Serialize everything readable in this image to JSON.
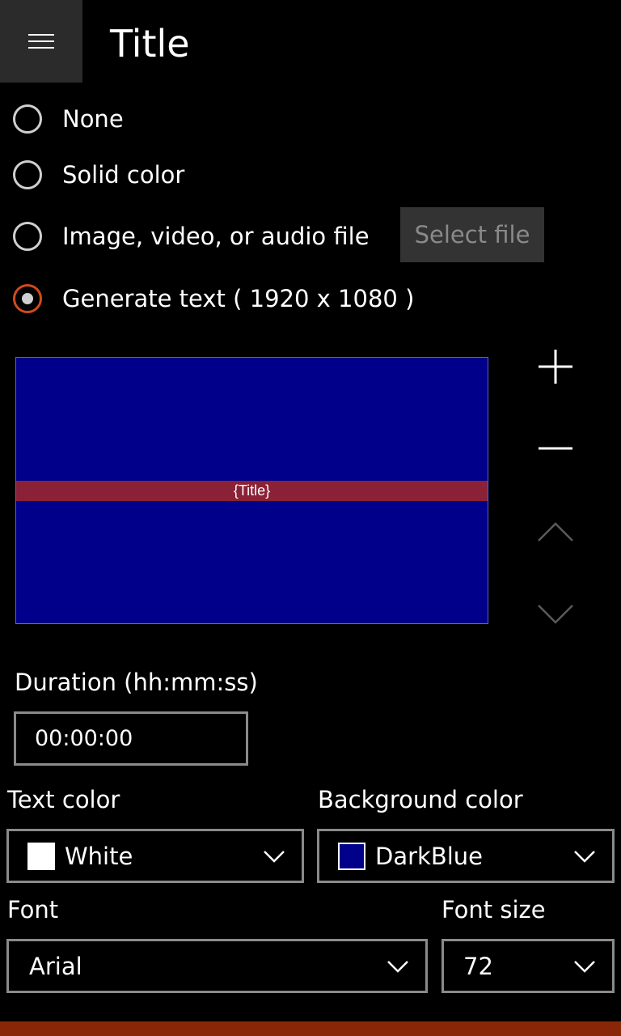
{
  "header": {
    "title": "Title",
    "menu_icon": "hamburger-icon"
  },
  "source_options": [
    {
      "label": "None",
      "checked": false
    },
    {
      "label": "Solid color",
      "checked": false
    },
    {
      "label": "Image, video, or audio file",
      "checked": false
    },
    {
      "label": "Generate text ( 1920 x 1080 )",
      "checked": true
    }
  ],
  "select_file_label": "Select file",
  "preview": {
    "title_text": "{Title}",
    "background": "#00008b",
    "band_color": "#8b2136"
  },
  "side_controls": [
    "plus-icon",
    "minus-icon",
    "chevron-up-icon",
    "chevron-down-icon"
  ],
  "duration": {
    "label": "Duration (hh:mm:ss)",
    "value": "00:00:00"
  },
  "text_color": {
    "label": "Text color",
    "value": "White",
    "swatch": "#ffffff"
  },
  "background_color": {
    "label": "Background color",
    "value": "DarkBlue",
    "swatch": "#00008b"
  },
  "font": {
    "label": "Font",
    "value": "Arial"
  },
  "font_size": {
    "label": "Font size",
    "value": "72"
  },
  "accent_color": "#d04a1c"
}
